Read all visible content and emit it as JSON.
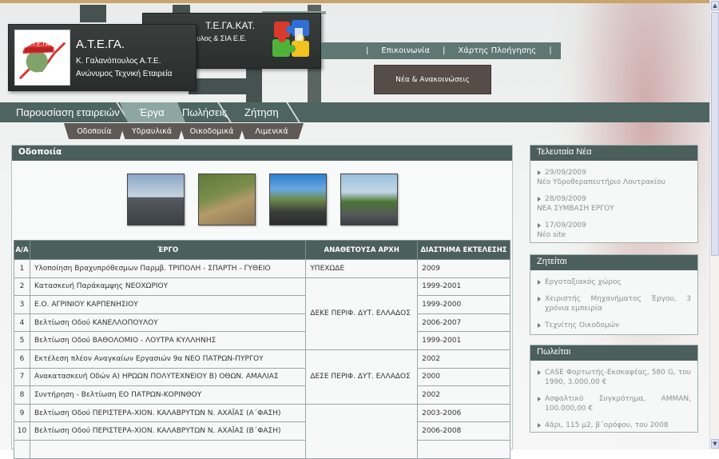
{
  "brand": {
    "name": "Α.Τ.Ε.ΓΑ.",
    "line1": "Κ. Γαλανόπουλος Α.Τ.Ε.",
    "line2": "Ανώνυμος Τεχνική Εταιρεία",
    "logo_text": "Α.Τ.Ε.ΓΑ."
  },
  "brand2": {
    "name": "Τ.Ε.ΓΑ.ΚΑΤ.",
    "line1": "Γ. Γαλανόπουλος & ΣΙΑ Ε.Ε."
  },
  "topnav": {
    "sep": "|",
    "contact": "Επικοινωνία",
    "sitemap": "Χάρτης Πλοήγησης"
  },
  "news_button": "Νέα & Ανακοινώσεις",
  "mainnav": [
    {
      "label": "Παρουσίαση εταιρειών"
    },
    {
      "label": "Έργα"
    },
    {
      "label": "Πωλήσεις"
    },
    {
      "label": "Ζήτηση"
    }
  ],
  "subnav": [
    {
      "label": "Οδοποιία"
    },
    {
      "label": "Υδραυλικά"
    },
    {
      "label": "Οικοδομικά"
    },
    {
      "label": "Λιμενικά"
    }
  ],
  "content": {
    "title": "Οδοποιία"
  },
  "table": {
    "headers": [
      "Α/Α",
      "ΈΡΓΟ",
      "ΑΝΑΘΕΤΟΥΣΑ ΑΡΧΗ",
      "ΔΙΑΣΤΗΜΑ ΕΚΤΕΛΕΣΗΣ"
    ],
    "rows": [
      {
        "n": "1",
        "project": "Υλοποίηση Βραχυπρόθεσμων Παρμβ. ΤΡΙΠΟΛΗ - ΣΠΑΡΤΗ - ΓΥΘΕΙΟ",
        "authority": "ΥΠΕΧΩΔΕ",
        "period": "2009"
      },
      {
        "n": "2",
        "project": "Κατασκευή Παράκαμψης ΝΕΟΧΩΡΙΟΥ",
        "period": "1999-2001"
      },
      {
        "n": "3",
        "project": "Ε.Ο. ΑΓΡΙΝΙΟΥ ΚΑΡΠΕΝΗΣΙΟΥ",
        "period": "1999-2000"
      },
      {
        "n": "4",
        "project": "Βελτίωση Οδού ΚΑΝΕΛΛΟΠΟΥΛΟΥ",
        "period": "2006-2007"
      },
      {
        "n": "5",
        "project": "Βελτίωση Οδού ΒΑΘΟΛΟΜΙΟ - ΛΟΥΤΡΑ ΚΥΛΛΗΝΗΣ",
        "period": "1999-2001"
      },
      {
        "n": "6",
        "project": "Εκτέλεση πλέον Αναγκαίων Εργασιών 9α ΝΕΟ ΠΑΤΡΩΝ-ΠΥΡΓΟΥ",
        "period": "2002"
      },
      {
        "n": "7",
        "project": "Ανακατασκευή Οδών Α) ΗΡΩΩΝ ΠΟΛΥΤΕΧΝΕΙΟΥ Β) ΟΘΩΝ. ΑΜΑΛΙΑΣ",
        "period": "2000"
      },
      {
        "n": "8",
        "project": "Συντήρηση - Βελτίωση ΕΟ ΠΑΤΡΩΝ-ΚΟΡΙΝΘΟΥ",
        "period": "2002"
      },
      {
        "n": "9",
        "project": "Βελτίωση Οδού ΠΕΡΙΣΤΕΡΑ-ΧΙΟΝ. ΚΑΛΑΒΡΥΤΩΝ Ν. ΑΧΑΪΑΣ (Α΄ΦΑΣΗ)",
        "period": "2003-2006"
      },
      {
        "n": "10",
        "project": "Βελτίωση Οδού ΠΕΡΙΣΤΕΡΑ-ΧΙΟΝ. ΚΑΛΑΒΡΥΤΩΝ Ν. ΑΧΑΪΑΣ (Β΄ΦΑΣΗ)",
        "period": "2006-2008"
      }
    ],
    "group_authority_1": "ΔΕΚΕ ΠΕΡΙΦ. ΔΥΤ. ΕΛΛΑΔΟΣ",
    "group_authority_2": "ΔΕΣΕ ΠΕΡΙΦ. ΔΥΤ. ΕΛΛΑΔΟΣ"
  },
  "news": {
    "title": "Τελευταία Νέα",
    "items": [
      {
        "date": "29/09/2009",
        "text": "Νέο Υδροθεραπευτήριο Λουτρακίου"
      },
      {
        "date": "28/09/2009",
        "text": "ΝΕΑ ΣΥΜΒΑΣΗ ΕΡΓΟΥ"
      },
      {
        "date": "17/09/2009",
        "text": "Νέο site"
      }
    ]
  },
  "wanted": {
    "title": "Ζητείται",
    "items": [
      "Εργοταξιακός χώρος",
      "Χειριστής Μηχανήματος Έργου, 3 χρόνια εμπειρία",
      "Τεχνίτης Οικοδομών"
    ]
  },
  "sale": {
    "title": "Πωλείται",
    "items": [
      "CASE Φορτωτής-Εκσκαφέας, 580 G, του 1990, 3.000,00 €",
      "Ασφαλτικό Συγκρότημα, AMMAN, 100.000,00 €",
      "4άρι, 115 μ2, β΄ορόφου, του 2008"
    ]
  },
  "colors": {
    "header_teal": "#4b5f5c",
    "nav_teal": "#4e6461",
    "active_tab": "#8da6a2",
    "subnav_brown": "#5f5955"
  }
}
